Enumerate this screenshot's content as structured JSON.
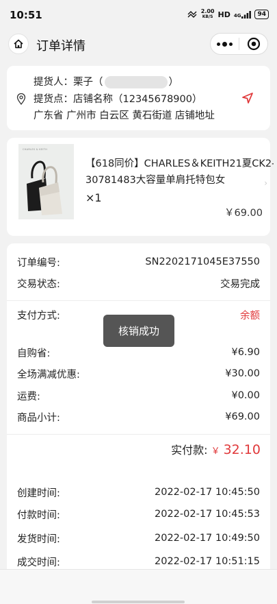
{
  "status_bar": {
    "time": "10:51",
    "speed_value": "2.00",
    "speed_unit": "KB/S",
    "hd": "HD",
    "signal": "4G",
    "battery": "94"
  },
  "nav": {
    "title": "订单详情"
  },
  "pickup": {
    "picker_label": "提货人：栗子（",
    "picker_suffix": "）",
    "point_label": "提货点：店铺名称（12345678900）",
    "address": "广东省 广州市 白云区 黄石街道 店铺地址"
  },
  "product": {
    "brand_mark": "CHARLES & KEITH",
    "name_line1": "【618同价】CHARLES＆KEITH21夏CK2-",
    "name_line2": "30781483大容量单肩托特包女",
    "quantity": "×1",
    "price": "￥69.00"
  },
  "order": {
    "number_label": "订单编号:",
    "number_value": "SN2202171045E37550",
    "status_label": "交易状态:",
    "status_value": "交易完成",
    "payment_label": "支付方式:",
    "payment_value": "余额",
    "self_pickup_label": "自购省:",
    "self_pickup_value": "¥6.90",
    "discount_label": "全场满减优惠:",
    "discount_value": "¥30.00",
    "shipping_label": "运费:",
    "shipping_value": "¥0.00",
    "subtotal_label": "商品小计:",
    "subtotal_value": "¥69.00",
    "paid_label": "实付款:",
    "paid_currency": "￥",
    "paid_amount": "32.10",
    "created_label": "创建时间:",
    "created_value": "2022-02-17 10:45:50",
    "paid_time_label": "付款时间:",
    "paid_time_value": "2022-02-17 10:45:53",
    "shipped_label": "发货时间:",
    "shipped_value": "2022-02-17 10:49:50",
    "completed_label": "成交时间:",
    "completed_value": "2022-02-17 10:51:15"
  },
  "toast": {
    "text": "核销成功"
  },
  "colors": {
    "accent_red": "#e0383a",
    "background": "#f2f2f2"
  }
}
